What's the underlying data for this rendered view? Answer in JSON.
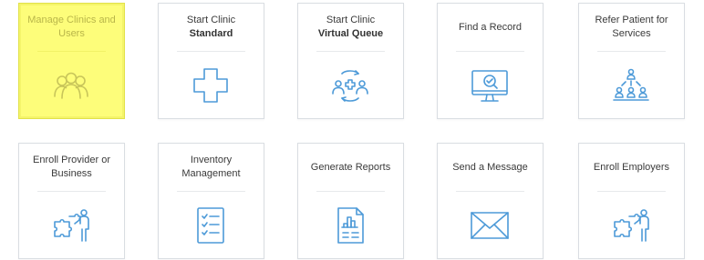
{
  "tiles": [
    {
      "line1": "Manage Clinics and",
      "line2": "Users",
      "icon": "users-icon",
      "highlighted": true
    },
    {
      "line1": "Start Clinic",
      "line2": "Standard",
      "icon": "medical-cross-icon"
    },
    {
      "line1": "Start Clinic",
      "line2": "Virtual Queue",
      "icon": "virtual-queue-icon"
    },
    {
      "line1": "Find a Record",
      "icon": "monitor-search-icon"
    },
    {
      "line1": "Refer Patient for",
      "line2": "Services",
      "icon": "referral-tree-icon"
    },
    {
      "line1": "Enroll Provider or",
      "line2": "Business",
      "icon": "puzzle-person-icon"
    },
    {
      "line1": "Inventory",
      "line2": "Management",
      "icon": "checklist-icon"
    },
    {
      "line1": "Generate Reports",
      "icon": "report-chart-icon"
    },
    {
      "line1": "Send a Message",
      "icon": "envelope-icon"
    },
    {
      "line1": "Enroll Employers",
      "icon": "puzzle-person-icon"
    }
  ],
  "colors": {
    "icon": "#4d9ad8",
    "highlight_bg": "#fdfd7a",
    "highlight_text": "#b9b64a",
    "border": "#d9dde2"
  }
}
